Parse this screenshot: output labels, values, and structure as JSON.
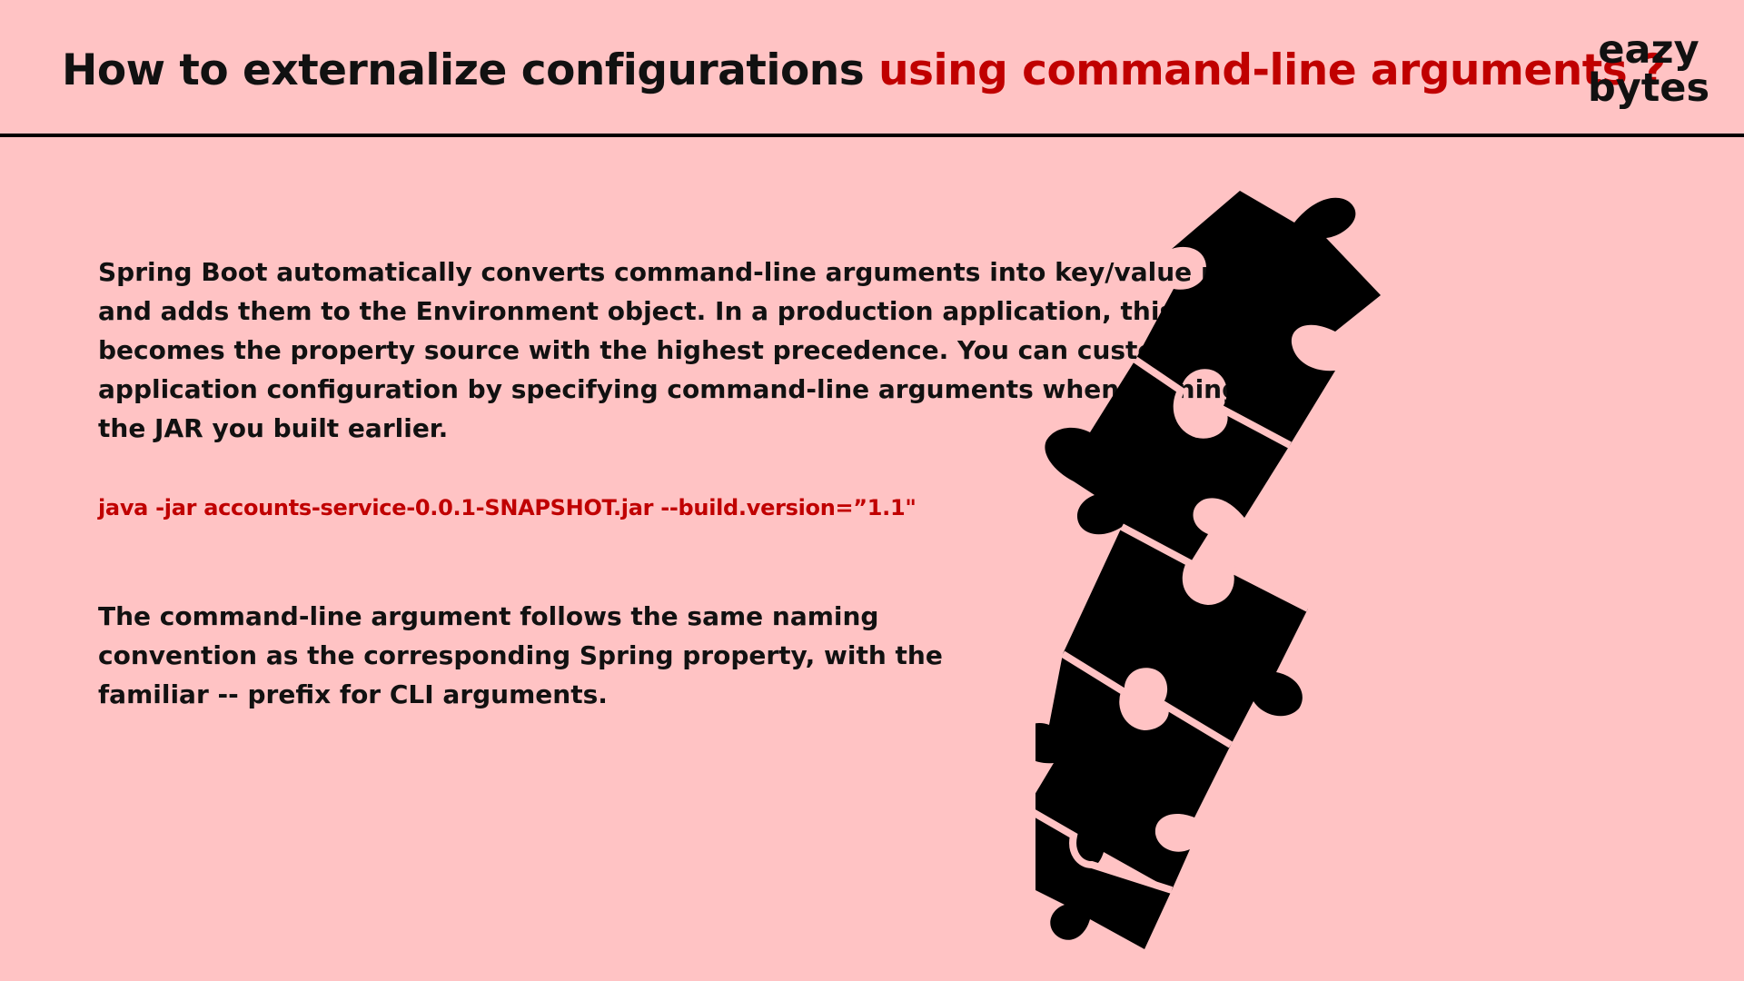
{
  "header": {
    "title_part1": "How to externalize configurations ",
    "title_part2": "using command-line arguments ?",
    "logo_line1": "eazy",
    "logo_line2": "bytes"
  },
  "content": {
    "paragraph1": "Spring Boot automatically converts command-line arguments into key/value pairs and adds them to the Environment object. In a production application, this becomes the property source with the highest precedence. You can customize the application configuration by specifying command-line arguments when running the JAR you built earlier.",
    "command": "java -jar accounts-service-0.0.1-SNAPSHOT.jar --build.version=”1.1\"",
    "paragraph2": "The command-line argument follows the same naming convention as the corresponding Spring property, with the familiar -- prefix for CLI arguments."
  },
  "illustration": {
    "icon": "puzzle-pieces-icon",
    "color": "#000000",
    "outline_color": "#ffc3c4"
  },
  "colors": {
    "background": "#ffc3c4",
    "accent": "#c00000",
    "text": "#111111"
  }
}
